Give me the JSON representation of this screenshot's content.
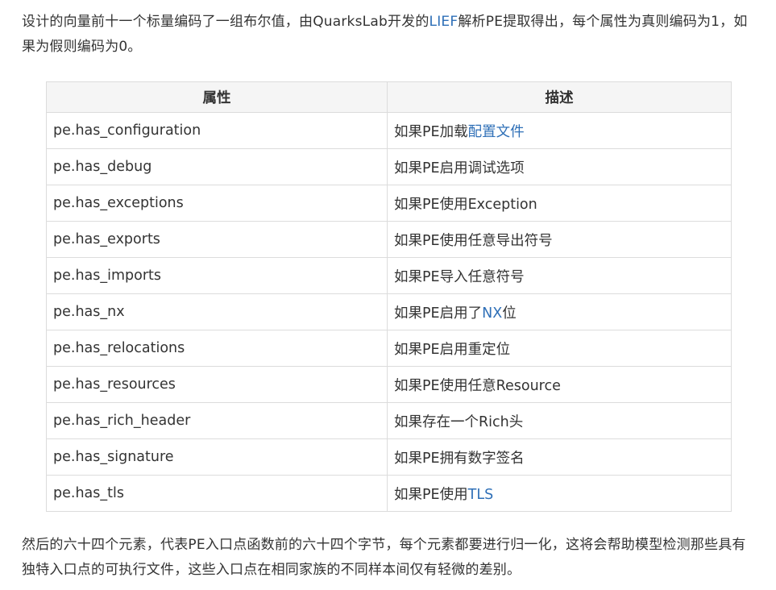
{
  "intro": {
    "before_link": "设计的向量前十一个标量编码了一组布尔值，由QuarksLab开发的",
    "link_text": "LIEF",
    "after_link": "解析PE提取得出，每个属性为真则编码为1，如果为假则编码为0。"
  },
  "table": {
    "headers": [
      "属性",
      "描述"
    ],
    "rows": [
      {
        "attr": "pe.has_configuration",
        "desc_pre": "如果PE加载",
        "desc_link": "配置文件",
        "desc_post": ""
      },
      {
        "attr": "pe.has_debug",
        "desc_pre": "如果PE启用调试选项",
        "desc_link": "",
        "desc_post": ""
      },
      {
        "attr": "pe.has_exceptions",
        "desc_pre": "如果PE使用Exception",
        "desc_link": "",
        "desc_post": ""
      },
      {
        "attr": "pe.has_exports",
        "desc_pre": "如果PE使用任意导出符号",
        "desc_link": "",
        "desc_post": ""
      },
      {
        "attr": "pe.has_imports",
        "desc_pre": "如果PE导入任意符号",
        "desc_link": "",
        "desc_post": ""
      },
      {
        "attr": "pe.has_nx",
        "desc_pre": "如果PE启用了",
        "desc_link": "NX",
        "desc_post": "位"
      },
      {
        "attr": "pe.has_relocations",
        "desc_pre": "如果PE启用重定位",
        "desc_link": "",
        "desc_post": ""
      },
      {
        "attr": "pe.has_resources",
        "desc_pre": "如果PE使用任意Resource",
        "desc_link": "",
        "desc_post": ""
      },
      {
        "attr": "pe.has_rich_header",
        "desc_pre": "如果存在一个Rich头",
        "desc_link": "",
        "desc_post": ""
      },
      {
        "attr": "pe.has_signature",
        "desc_pre": "如果PE拥有数字签名",
        "desc_link": "",
        "desc_post": ""
      },
      {
        "attr": "pe.has_tls",
        "desc_pre": "如果PE使用",
        "desc_link": "TLS",
        "desc_post": ""
      }
    ]
  },
  "outro": "然后的六十四个元素，代表PE入口点函数前的六十四个字节，每个元素都要进行归一化，这将会帮助模型检测那些具有独特入口点的可执行文件，这些入口点在相同家族的不同样本间仅有轻微的差别。",
  "colors": {
    "link": "#2e6fb7",
    "text": "#333333",
    "header_bg": "#f5f5f5",
    "border": "#dcdcdc"
  }
}
